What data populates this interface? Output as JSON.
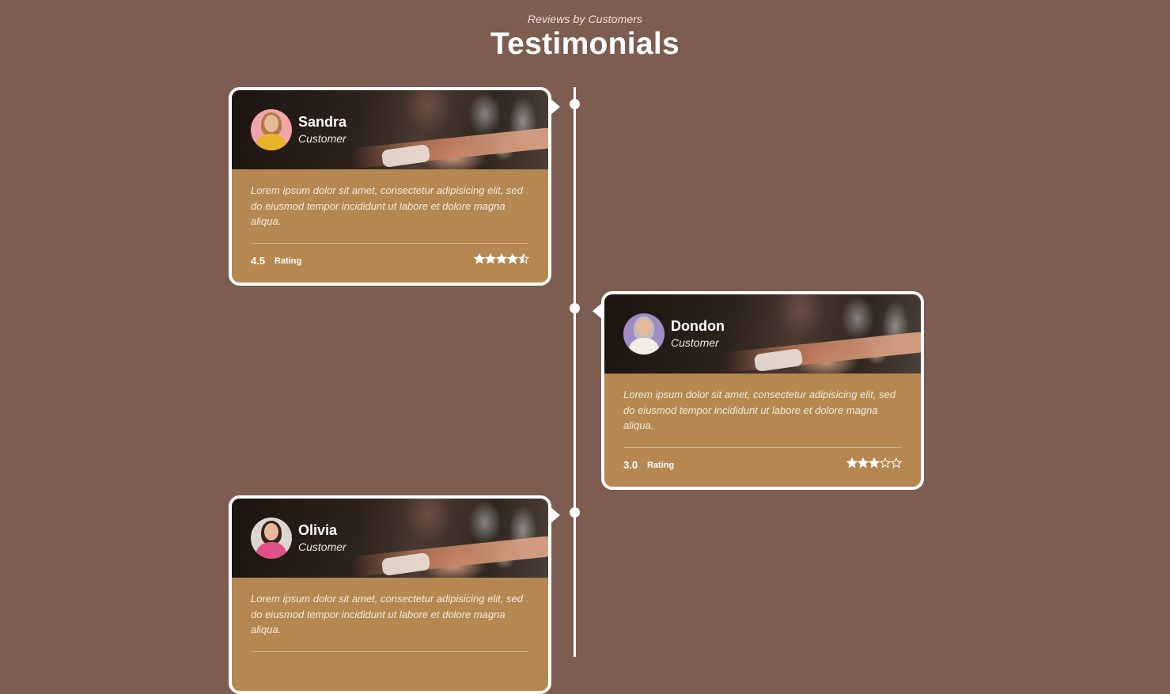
{
  "header": {
    "subtitle": "Reviews by Customers",
    "title": "Testimonials"
  },
  "colors": {
    "background": "#7d5c52",
    "card_body": "#b48850",
    "card_border": "#ffffff"
  },
  "testimonials": [
    {
      "name": "Sandra",
      "role": "Customer",
      "quote": "Lorem ipsum dolor sit amet, consectetur adipisicing elit, sed do eiusmod tempor incididunt ut labore et dolore magna aliqua.",
      "rating_value": "4.5",
      "rating_label": "Rating",
      "stars": 4.5,
      "avatar_icon": "woman-avatar-icon"
    },
    {
      "name": "Dondon",
      "role": "Customer",
      "quote": "Lorem ipsum dolor sit amet, consectetur adipisicing elit, sed do eiusmod tempor incididunt ut labore et dolore magna aliqua.",
      "rating_value": "3.0",
      "rating_label": "Rating",
      "stars": 3.0,
      "avatar_icon": "man-avatar-icon"
    },
    {
      "name": "Olivia",
      "role": "Customer",
      "quote": "Lorem ipsum dolor sit amet, consectetur adipisicing elit, sed do eiusmod tempor incididunt ut labore et dolore magna aliqua.",
      "rating_value": "",
      "rating_label": "",
      "stars": null,
      "avatar_icon": "woman-avatar-icon"
    }
  ]
}
